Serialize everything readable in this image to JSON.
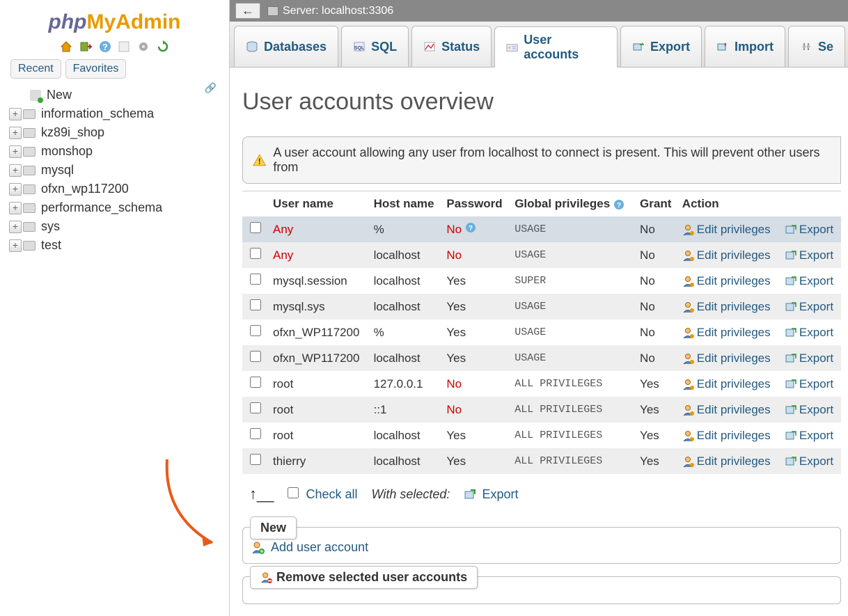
{
  "logo": {
    "part1": "php",
    "part2": "MyAdmin"
  },
  "sidebar_tabs": {
    "recent": "Recent",
    "favorites": "Favorites"
  },
  "tree": {
    "new_label": "New",
    "items": [
      "information_schema",
      "kz89i_shop",
      "monshop",
      "mysql",
      "ofxn_wp117200",
      "performance_schema",
      "sys",
      "test"
    ]
  },
  "topbar": {
    "server_label": "Server: localhost:3306"
  },
  "tabs": [
    {
      "label": "Databases",
      "active": false
    },
    {
      "label": "SQL",
      "active": false
    },
    {
      "label": "Status",
      "active": false
    },
    {
      "label": "User accounts",
      "active": true
    },
    {
      "label": "Export",
      "active": false
    },
    {
      "label": "Import",
      "active": false
    },
    {
      "label": "Se",
      "active": false
    }
  ],
  "page_title": "User accounts overview",
  "warning": "A user account allowing any user from localhost to connect is present. This will prevent other users from",
  "columns": {
    "user": "User name",
    "host": "Host name",
    "pass": "Password",
    "priv": "Global privileges",
    "grant": "Grant",
    "action": "Action"
  },
  "action_labels": {
    "edit": "Edit privileges",
    "export": "Export"
  },
  "rows": [
    {
      "user": "Any",
      "user_red": true,
      "host": "%",
      "pass": "No",
      "pass_red": true,
      "pass_help": true,
      "priv": "USAGE",
      "grant": "No",
      "row0": true
    },
    {
      "user": "Any",
      "user_red": true,
      "host": "localhost",
      "pass": "No",
      "pass_red": true,
      "priv": "USAGE",
      "grant": "No"
    },
    {
      "user": "mysql.session",
      "host": "localhost",
      "pass": "Yes",
      "priv": "SUPER",
      "grant": "No"
    },
    {
      "user": "mysql.sys",
      "host": "localhost",
      "pass": "Yes",
      "priv": "USAGE",
      "grant": "No"
    },
    {
      "user": "ofxn_WP117200",
      "host": "%",
      "pass": "Yes",
      "priv": "USAGE",
      "grant": "No"
    },
    {
      "user": "ofxn_WP117200",
      "host": "localhost",
      "pass": "Yes",
      "priv": "USAGE",
      "grant": "No"
    },
    {
      "user": "root",
      "host": "127.0.0.1",
      "pass": "No",
      "pass_red": true,
      "priv": "ALL PRIVILEGES",
      "grant": "Yes"
    },
    {
      "user": "root",
      "host": "::1",
      "pass": "No",
      "pass_red": true,
      "priv": "ALL PRIVILEGES",
      "grant": "Yes"
    },
    {
      "user": "root",
      "host": "localhost",
      "pass": "Yes",
      "priv": "ALL PRIVILEGES",
      "grant": "Yes"
    },
    {
      "user": "thierry",
      "host": "localhost",
      "pass": "Yes",
      "priv": "ALL PRIVILEGES",
      "grant": "Yes"
    }
  ],
  "below": {
    "check_all": "Check all",
    "with_selected": "With selected:",
    "export": "Export"
  },
  "new_box": {
    "legend": "New",
    "add": "Add user account"
  },
  "remove_box": {
    "legend": "Remove selected user accounts"
  }
}
